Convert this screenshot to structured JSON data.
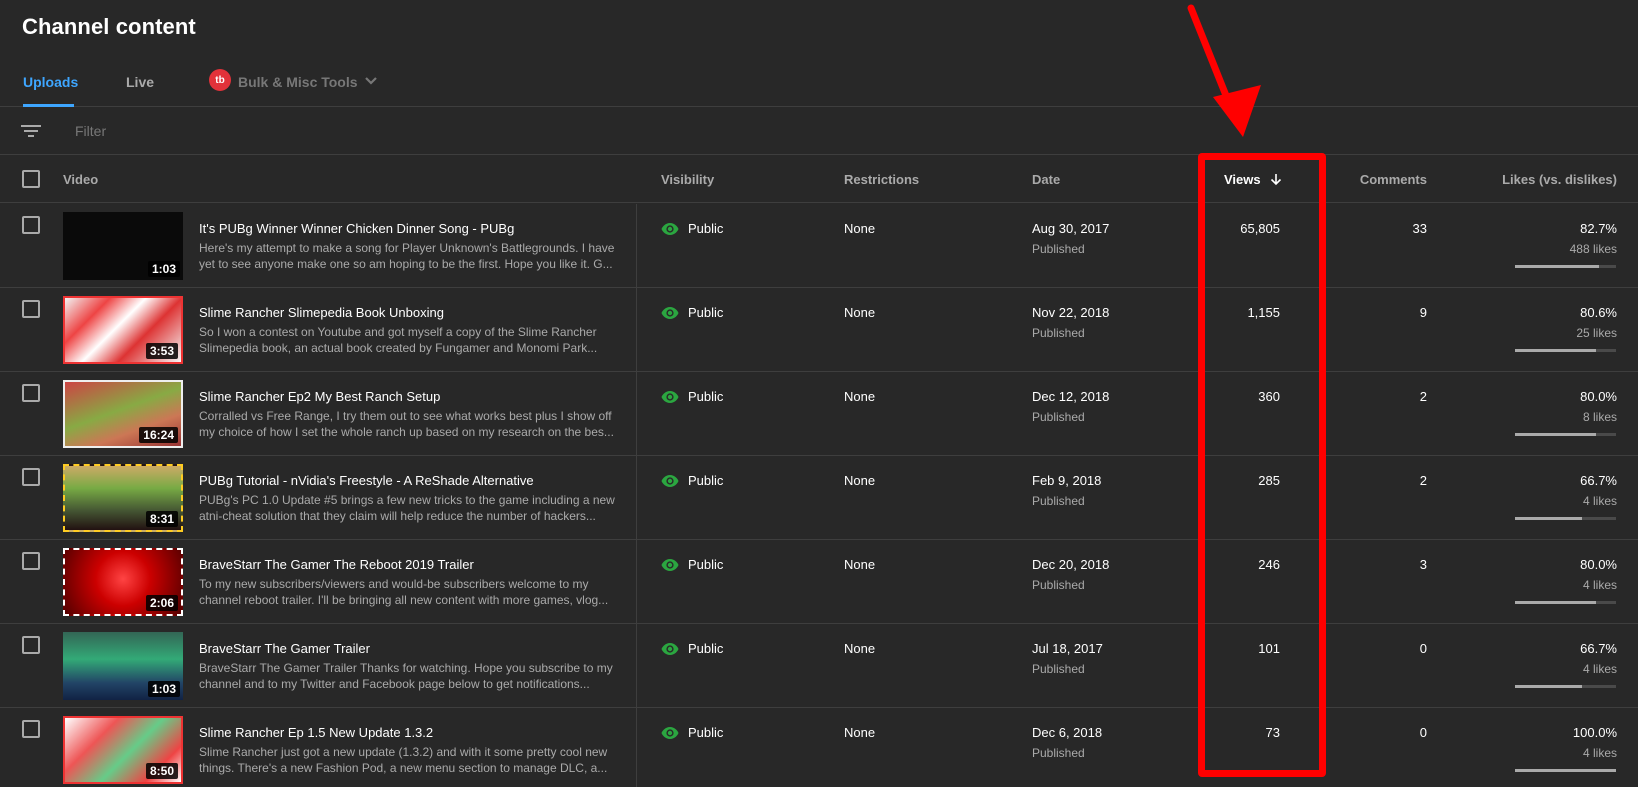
{
  "page": {
    "title": "Channel content"
  },
  "tabs": [
    {
      "label": "Uploads"
    },
    {
      "label": "Live"
    }
  ],
  "tubebuddy": {
    "badge": "tb",
    "label": "Bulk & Misc Tools"
  },
  "filter": {
    "placeholder": "Filter"
  },
  "columns": {
    "video": "Video",
    "visibility": "Visibility",
    "restrictions": "Restrictions",
    "date": "Date",
    "views": "Views",
    "comments": "Comments",
    "likes": "Likes (vs. dislikes)"
  },
  "icons": {
    "filter": "filter-lines-icon",
    "visibility": "eye-icon",
    "sort": "arrow-down-icon",
    "chevron": "chevron-down-icon"
  },
  "colors": {
    "accent": "#3ea6ff",
    "public": "#2ba640",
    "annotation": "#ff0000"
  },
  "rows": [
    {
      "title": "It's PUBg Winner Winner Chicken Dinner Song - PUBg",
      "description": "Here's my attempt to make a song for Player Unknown's Battlegrounds. I have yet to see anyone make one so am hoping to be the first. Hope you like it. G...",
      "duration": "1:03",
      "visibility": "Public",
      "restrictions": "None",
      "date": "Aug 30, 2017",
      "status": "Published",
      "views": "65,805",
      "comments": "33",
      "likes_pct": "82.7%",
      "likes_count": "488 likes",
      "like_ratio": 0.827
    },
    {
      "title": "Slime Rancher Slimepedia Book Unboxing",
      "description": "So I won a contest on Youtube and got myself a copy of the Slime Rancher Slimepedia book, an actual book created by Fungamer and Monomi Park...",
      "duration": "3:53",
      "visibility": "Public",
      "restrictions": "None",
      "date": "Nov 22, 2018",
      "status": "Published",
      "views": "1,155",
      "comments": "9",
      "likes_pct": "80.6%",
      "likes_count": "25 likes",
      "like_ratio": 0.806
    },
    {
      "title": "Slime Rancher Ep2 My Best Ranch Setup",
      "description": "Corralled vs Free Range, I try them out to see what works best plus I show off my choice of how I set the whole ranch up based on my research on the bes...",
      "duration": "16:24",
      "visibility": "Public",
      "restrictions": "None",
      "date": "Dec 12, 2018",
      "status": "Published",
      "views": "360",
      "comments": "2",
      "likes_pct": "80.0%",
      "likes_count": "8 likes",
      "like_ratio": 0.8
    },
    {
      "title": "PUBg Tutorial - nVidia's Freestyle - A ReShade Alternative",
      "description": "PUBg's PC 1.0 Update #5 brings a few new tricks to the game including a new atni-cheat solution that they claim will help reduce the number of hackers...",
      "duration": "8:31",
      "visibility": "Public",
      "restrictions": "None",
      "date": "Feb 9, 2018",
      "status": "Published",
      "views": "285",
      "comments": "2",
      "likes_pct": "66.7%",
      "likes_count": "4 likes",
      "like_ratio": 0.667
    },
    {
      "title": "BraveStarr The Gamer The Reboot 2019 Trailer",
      "description": "To my new subscribers/viewers and would-be subscribers welcome to my channel reboot trailer. I'll be bringing all new content with more games, vlog...",
      "duration": "2:06",
      "visibility": "Public",
      "restrictions": "None",
      "date": "Dec 20, 2018",
      "status": "Published",
      "views": "246",
      "comments": "3",
      "likes_pct": "80.0%",
      "likes_count": "4 likes",
      "like_ratio": 0.8
    },
    {
      "title": "BraveStarr The Gamer Trailer",
      "description": "BraveStarr The Gamer Trailer Thanks for watching. Hope you subscribe to my channel and to my Twitter and Facebook page below to get notifications...",
      "duration": "1:03",
      "visibility": "Public",
      "restrictions": "None",
      "date": "Jul 18, 2017",
      "status": "Published",
      "views": "101",
      "comments": "0",
      "likes_pct": "66.7%",
      "likes_count": "4 likes",
      "like_ratio": 0.667
    },
    {
      "title": "Slime Rancher Ep 1.5 New Update 1.3.2",
      "description": "Slime Rancher just got a new update (1.3.2) and with it some pretty cool new things. There's a new Fashion Pod, a new menu section to manage DLC, a...",
      "duration": "8:50",
      "visibility": "Public",
      "restrictions": "None",
      "date": "Dec 6, 2018",
      "status": "Published",
      "views": "73",
      "comments": "0",
      "likes_pct": "100.0%",
      "likes_count": "4 likes",
      "like_ratio": 1.0
    }
  ]
}
